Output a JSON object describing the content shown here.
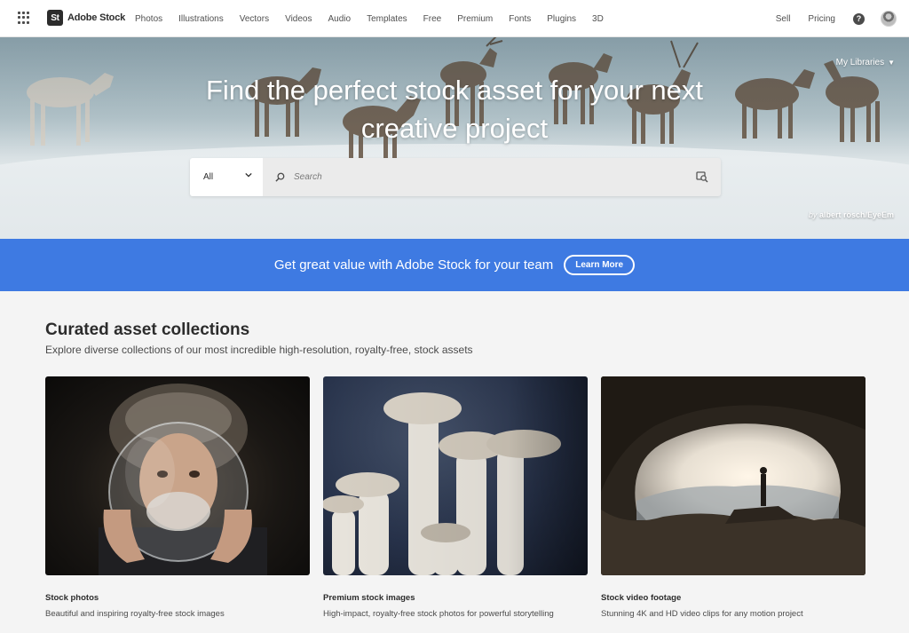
{
  "nav": {
    "logo_mark": "St",
    "logo_text": "Adobe Stock",
    "links": [
      "Photos",
      "Illustrations",
      "Vectors",
      "Videos",
      "Audio",
      "Templates",
      "Free",
      "Premium",
      "Fonts",
      "Plugins",
      "3D"
    ],
    "right_links": [
      "Sell",
      "Pricing"
    ],
    "help_glyph": "?",
    "icons": [
      "app-grid-icon",
      "help-icon",
      "avatar"
    ]
  },
  "hero": {
    "title_line1": "Find the perfect stock asset for your next",
    "title_line2": "creative project",
    "my_libraries": "My Libraries",
    "search": {
      "category": "All",
      "placeholder": "Search"
    },
    "credit_by": "by",
    "credit_name": "albert rösch/EyeEm"
  },
  "banner": {
    "text": "Get great value with Adobe Stock for your team",
    "button": "Learn More",
    "color": "#3e7ae2"
  },
  "collections": {
    "title": "Curated asset collections",
    "subtitle": "Explore diverse collections of our most incredible high-resolution, royalty-free, stock assets",
    "cards": [
      {
        "title": "Stock photos",
        "desc": "Beautiful and inspiring royalty-free stock images"
      },
      {
        "title": "Premium stock images",
        "desc": "High-impact, royalty-free stock photos for powerful storytelling"
      },
      {
        "title": "Stock video footage",
        "desc": "Stunning 4K and HD video clips for any motion project"
      }
    ]
  }
}
